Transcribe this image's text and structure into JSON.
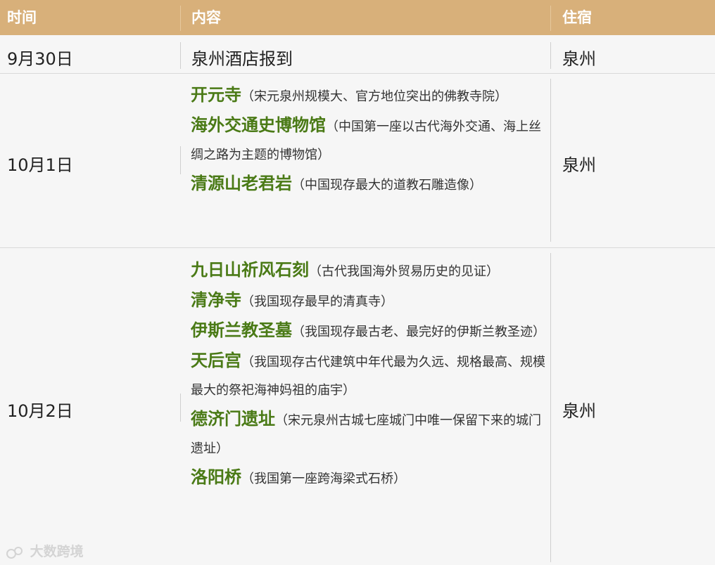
{
  "header": {
    "time": "时间",
    "content": "内容",
    "stay": "住宿"
  },
  "rows": [
    {
      "date": "9月30日",
      "stay": "泉州",
      "items": [
        {
          "name": "泉州酒店报到",
          "desc": ""
        }
      ]
    },
    {
      "date": "10月1日",
      "stay": "泉州",
      "items": [
        {
          "name": "开元寺",
          "desc": "（宋元泉州规模大、官方地位突出的佛教寺院）"
        },
        {
          "name": "海外交通史博物馆",
          "desc": "（中国第一座以古代海外交通、海上丝绸之路为主题的博物馆）"
        },
        {
          "name": "清源山老君岩",
          "desc": "（中国现存最大的道教石雕造像）"
        }
      ]
    },
    {
      "date": "10月2日",
      "stay": "泉州",
      "items": [
        {
          "name": "九日山祈风石刻",
          "desc": "（古代我国海外贸易历史的见证）"
        },
        {
          "name": "清净寺",
          "desc": "（我国现存最早的清真寺）"
        },
        {
          "name": "伊斯兰教圣墓",
          "desc": "（我国现存最古老、最完好的伊斯兰教圣迹）"
        },
        {
          "name": "天后宫",
          "desc": "（我国现存古代建筑中年代最为久远、规格最高、规模最大的祭祀海神妈祖的庙宇）"
        },
        {
          "name": "德济门遗址",
          "desc": "（宋元泉州古城七座城门中唯一保留下来的城门遗址）"
        },
        {
          "name": "洛阳桥",
          "desc": "（我国第一座跨海梁式石桥）"
        }
      ]
    }
  ],
  "watermark": "大数跨境"
}
